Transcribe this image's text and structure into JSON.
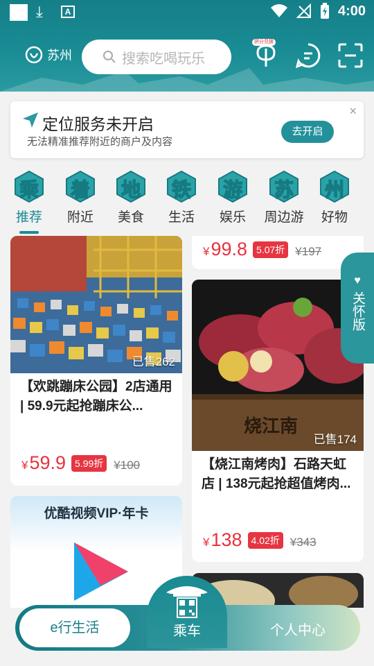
{
  "status_bar": {
    "time": "4:00"
  },
  "header": {
    "city": "苏州",
    "search_placeholder": "搜索吃喝玩乐",
    "badge_text": "拼分兑换"
  },
  "location_card": {
    "title": "定位服务未开启",
    "subtitle": "无法精准推荐附近的商户及内容",
    "button": "去开启",
    "close": "×"
  },
  "categories": [
    {
      "glyph": "乘",
      "label": "推荐"
    },
    {
      "glyph": "着",
      "label": "附近"
    },
    {
      "glyph": "地",
      "label": "美食"
    },
    {
      "glyph": "铁",
      "label": "生活"
    },
    {
      "glyph": "游",
      "label": "娱乐"
    },
    {
      "glyph": "苏",
      "label": "周边游"
    },
    {
      "glyph": "州",
      "label": "好物"
    }
  ],
  "feed": {
    "top_right": {
      "yen": "¥",
      "price": "99.8",
      "discount": "5.07折",
      "original": "¥197"
    },
    "trampoline": {
      "sold": "已售262",
      "title": "【欢跳蹦床公园】2店通用 | 59.9元起抢蹦床公...",
      "yen": "¥",
      "price": "59.9",
      "discount": "5.99折",
      "original": "¥100"
    },
    "bbq": {
      "sold": "已售174",
      "title": "【烧江南烤肉】石路天虹店 | 138元起抢超值烤肉...",
      "yen": "¥",
      "price": "138",
      "discount": "4.02折",
      "original": "¥343",
      "box_text": "烧江南"
    },
    "youku": {
      "banner": "优酷视频VIP·年卡"
    }
  },
  "care_tab": {
    "icon": "♥",
    "label": "关怀版"
  },
  "bottom_nav": {
    "life": "e行生活",
    "ride": "乘车",
    "mine": "个人中心"
  },
  "colors": {
    "brand": "#1a8b93",
    "price": "#e8313d"
  }
}
